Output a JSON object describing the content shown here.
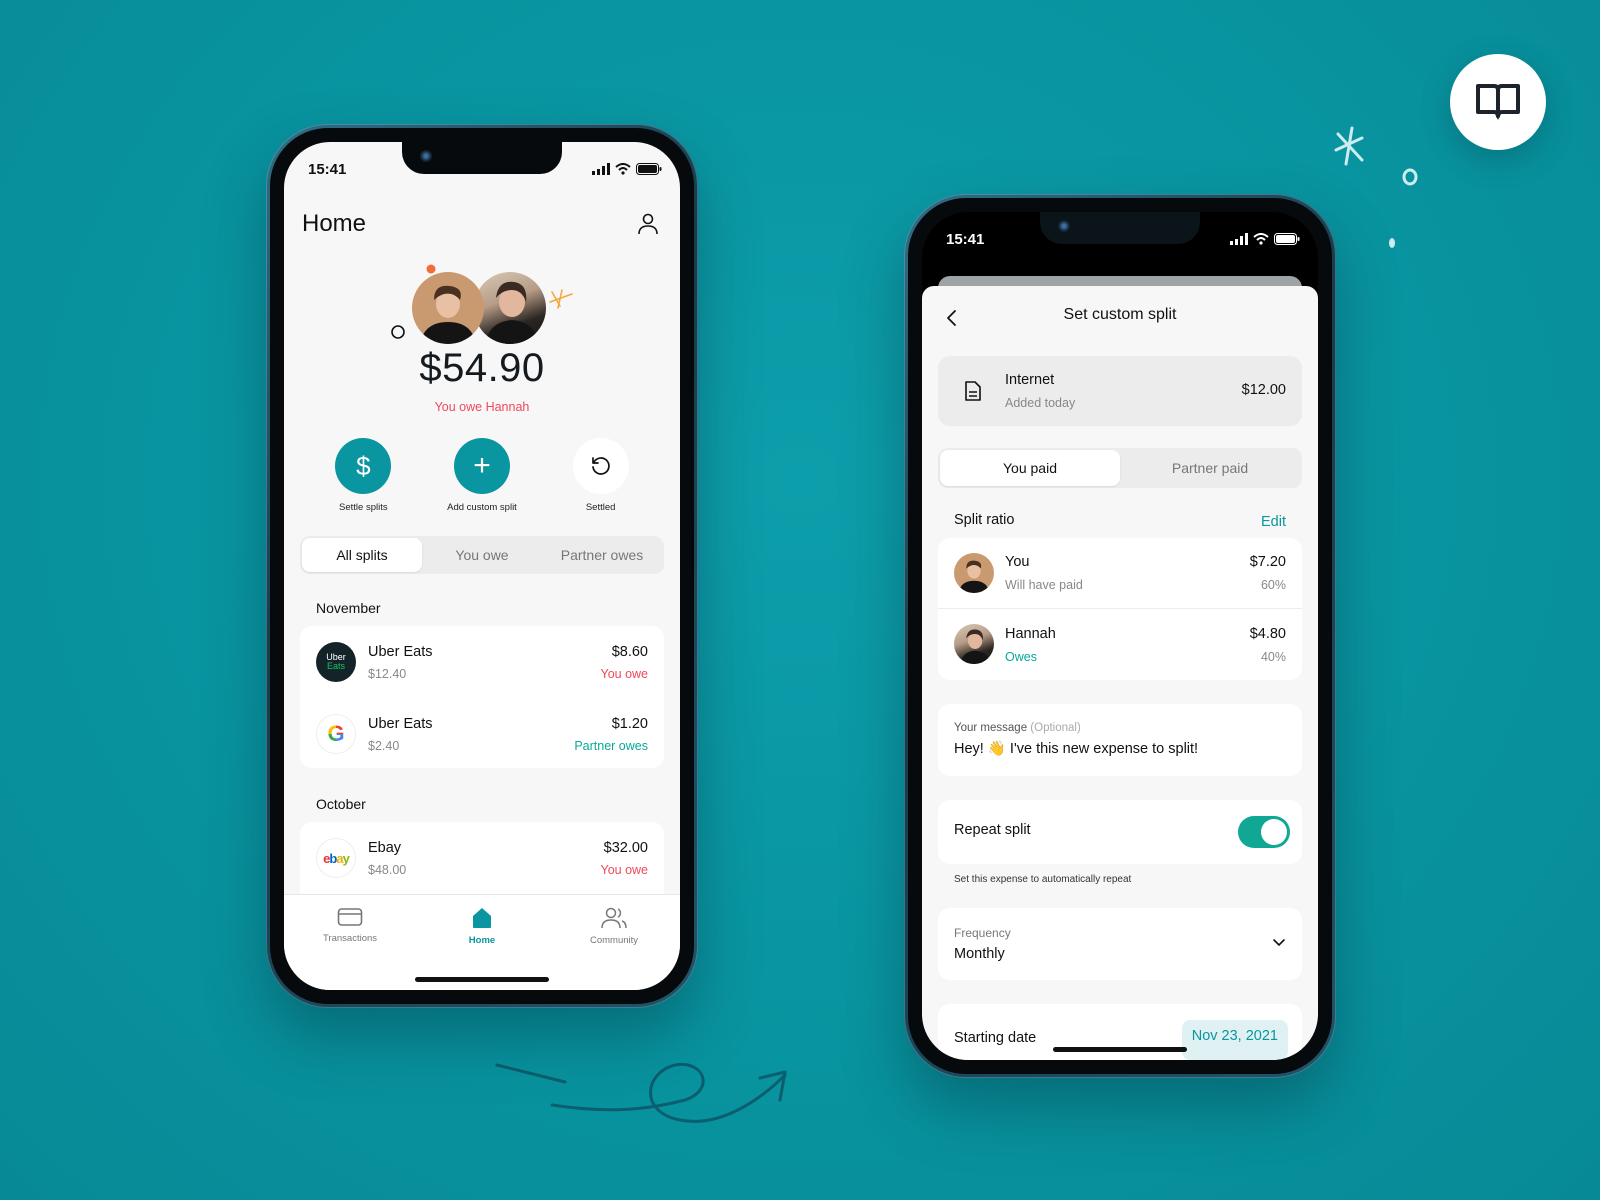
{
  "colors": {
    "background": "#08939f",
    "accent": "#0a96a0",
    "owe_red": "#ee4a5a",
    "partner_teal": "#0aa89a",
    "toggle_on": "#10a894"
  },
  "decor": {
    "book_icon": "book-open-icon"
  },
  "home_screen": {
    "status_time": "15:41",
    "title": "Home",
    "profile_icon": "user-icon",
    "balance": "$54.90",
    "balance_caption": "You owe Hannah",
    "actions": [
      {
        "label": "Settle splits",
        "icon": "dollar-icon",
        "glyph": "$"
      },
      {
        "label": "Add custom split",
        "icon": "plus-icon",
        "glyph": "+"
      },
      {
        "label": "Settled",
        "icon": "history-icon",
        "glyph": "⟲"
      }
    ],
    "filter_tabs": [
      {
        "label": "All splits",
        "active": true
      },
      {
        "label": "You owe",
        "active": false
      },
      {
        "label": "Partner owes",
        "active": false
      }
    ],
    "groups": [
      {
        "month": "November",
        "items": [
          {
            "merchant": "Uber Eats",
            "total": "$12.40",
            "amount": "$8.60",
            "status": "You owe",
            "logo": "uber-eats-logo"
          },
          {
            "merchant": "Uber Eats",
            "total": "$2.40",
            "amount": "$1.20",
            "status": "Partner owes",
            "logo": "google-logo"
          }
        ]
      },
      {
        "month": "October",
        "items": [
          {
            "merchant": "Ebay",
            "total": "$48.00",
            "amount": "$32.00",
            "status": "You owe",
            "logo": "ebay-logo"
          }
        ]
      }
    ],
    "uber_logo_text": [
      "Uber",
      "Eats"
    ],
    "ebay_logo_text": [
      "e",
      "b",
      "a",
      "y"
    ],
    "google_logo_text": "G",
    "tabbar": [
      {
        "label": "Transactions",
        "icon": "card-icon",
        "active": false
      },
      {
        "label": "Home",
        "icon": "home-icon",
        "active": true
      },
      {
        "label": "Community",
        "icon": "community-icon",
        "active": false
      }
    ]
  },
  "split_screen": {
    "status_time": "15:41",
    "title": "Set custom split",
    "expense": {
      "name": "Internet",
      "added": "Added today",
      "amount": "$12.00"
    },
    "payer_tabs": [
      {
        "label": "You paid",
        "active": true
      },
      {
        "label": "Partner paid",
        "active": false
      }
    ],
    "split_ratio_label": "Split ratio",
    "edit_label": "Edit",
    "people": [
      {
        "name": "You",
        "role": "Will have paid",
        "amount": "$7.20",
        "percent": "60%"
      },
      {
        "name": "Hannah",
        "role": "Owes",
        "amount": "$4.80",
        "percent": "40%"
      }
    ],
    "message": {
      "label": "Your message",
      "optional": "(Optional)",
      "value": "Hey! 👋 I've this new expense to split!"
    },
    "repeat": {
      "label": "Repeat split",
      "enabled": true,
      "hint": "Set this expense to automatically repeat"
    },
    "frequency": {
      "label": "Frequency",
      "value": "Monthly"
    },
    "starting_date": {
      "label": "Starting date",
      "value": "Nov 23, 2021"
    }
  }
}
